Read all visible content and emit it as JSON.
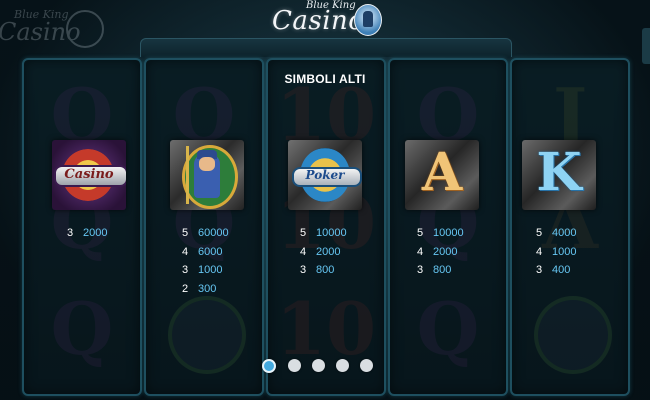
{
  "header": {
    "logo_small": "Blue King",
    "logo_word": "Casino"
  },
  "paytable": {
    "title": "SIMBOLI ALTI",
    "symbols": [
      {
        "name": "Casino",
        "payouts": [
          {
            "count": "3",
            "amount": "2000"
          }
        ]
      },
      {
        "name": "Blue King",
        "payouts": [
          {
            "count": "5",
            "amount": "60000"
          },
          {
            "count": "4",
            "amount": "6000"
          },
          {
            "count": "3",
            "amount": "1000"
          },
          {
            "count": "2",
            "amount": "300"
          }
        ]
      },
      {
        "name": "Poker",
        "payouts": [
          {
            "count": "5",
            "amount": "10000"
          },
          {
            "count": "4",
            "amount": "2000"
          },
          {
            "count": "3",
            "amount": "800"
          }
        ]
      },
      {
        "name": "A",
        "payouts": [
          {
            "count": "5",
            "amount": "10000"
          },
          {
            "count": "4",
            "amount": "2000"
          },
          {
            "count": "3",
            "amount": "800"
          }
        ]
      },
      {
        "name": "K",
        "payouts": [
          {
            "count": "5",
            "amount": "4000"
          },
          {
            "count": "4",
            "amount": "1000"
          },
          {
            "count": "3",
            "amount": "400"
          }
        ]
      }
    ]
  },
  "pagination": {
    "pages": 5,
    "active_index": 0
  },
  "colors": {
    "payout_amount": "#66c6f2",
    "active_dot": "#43a9df"
  }
}
